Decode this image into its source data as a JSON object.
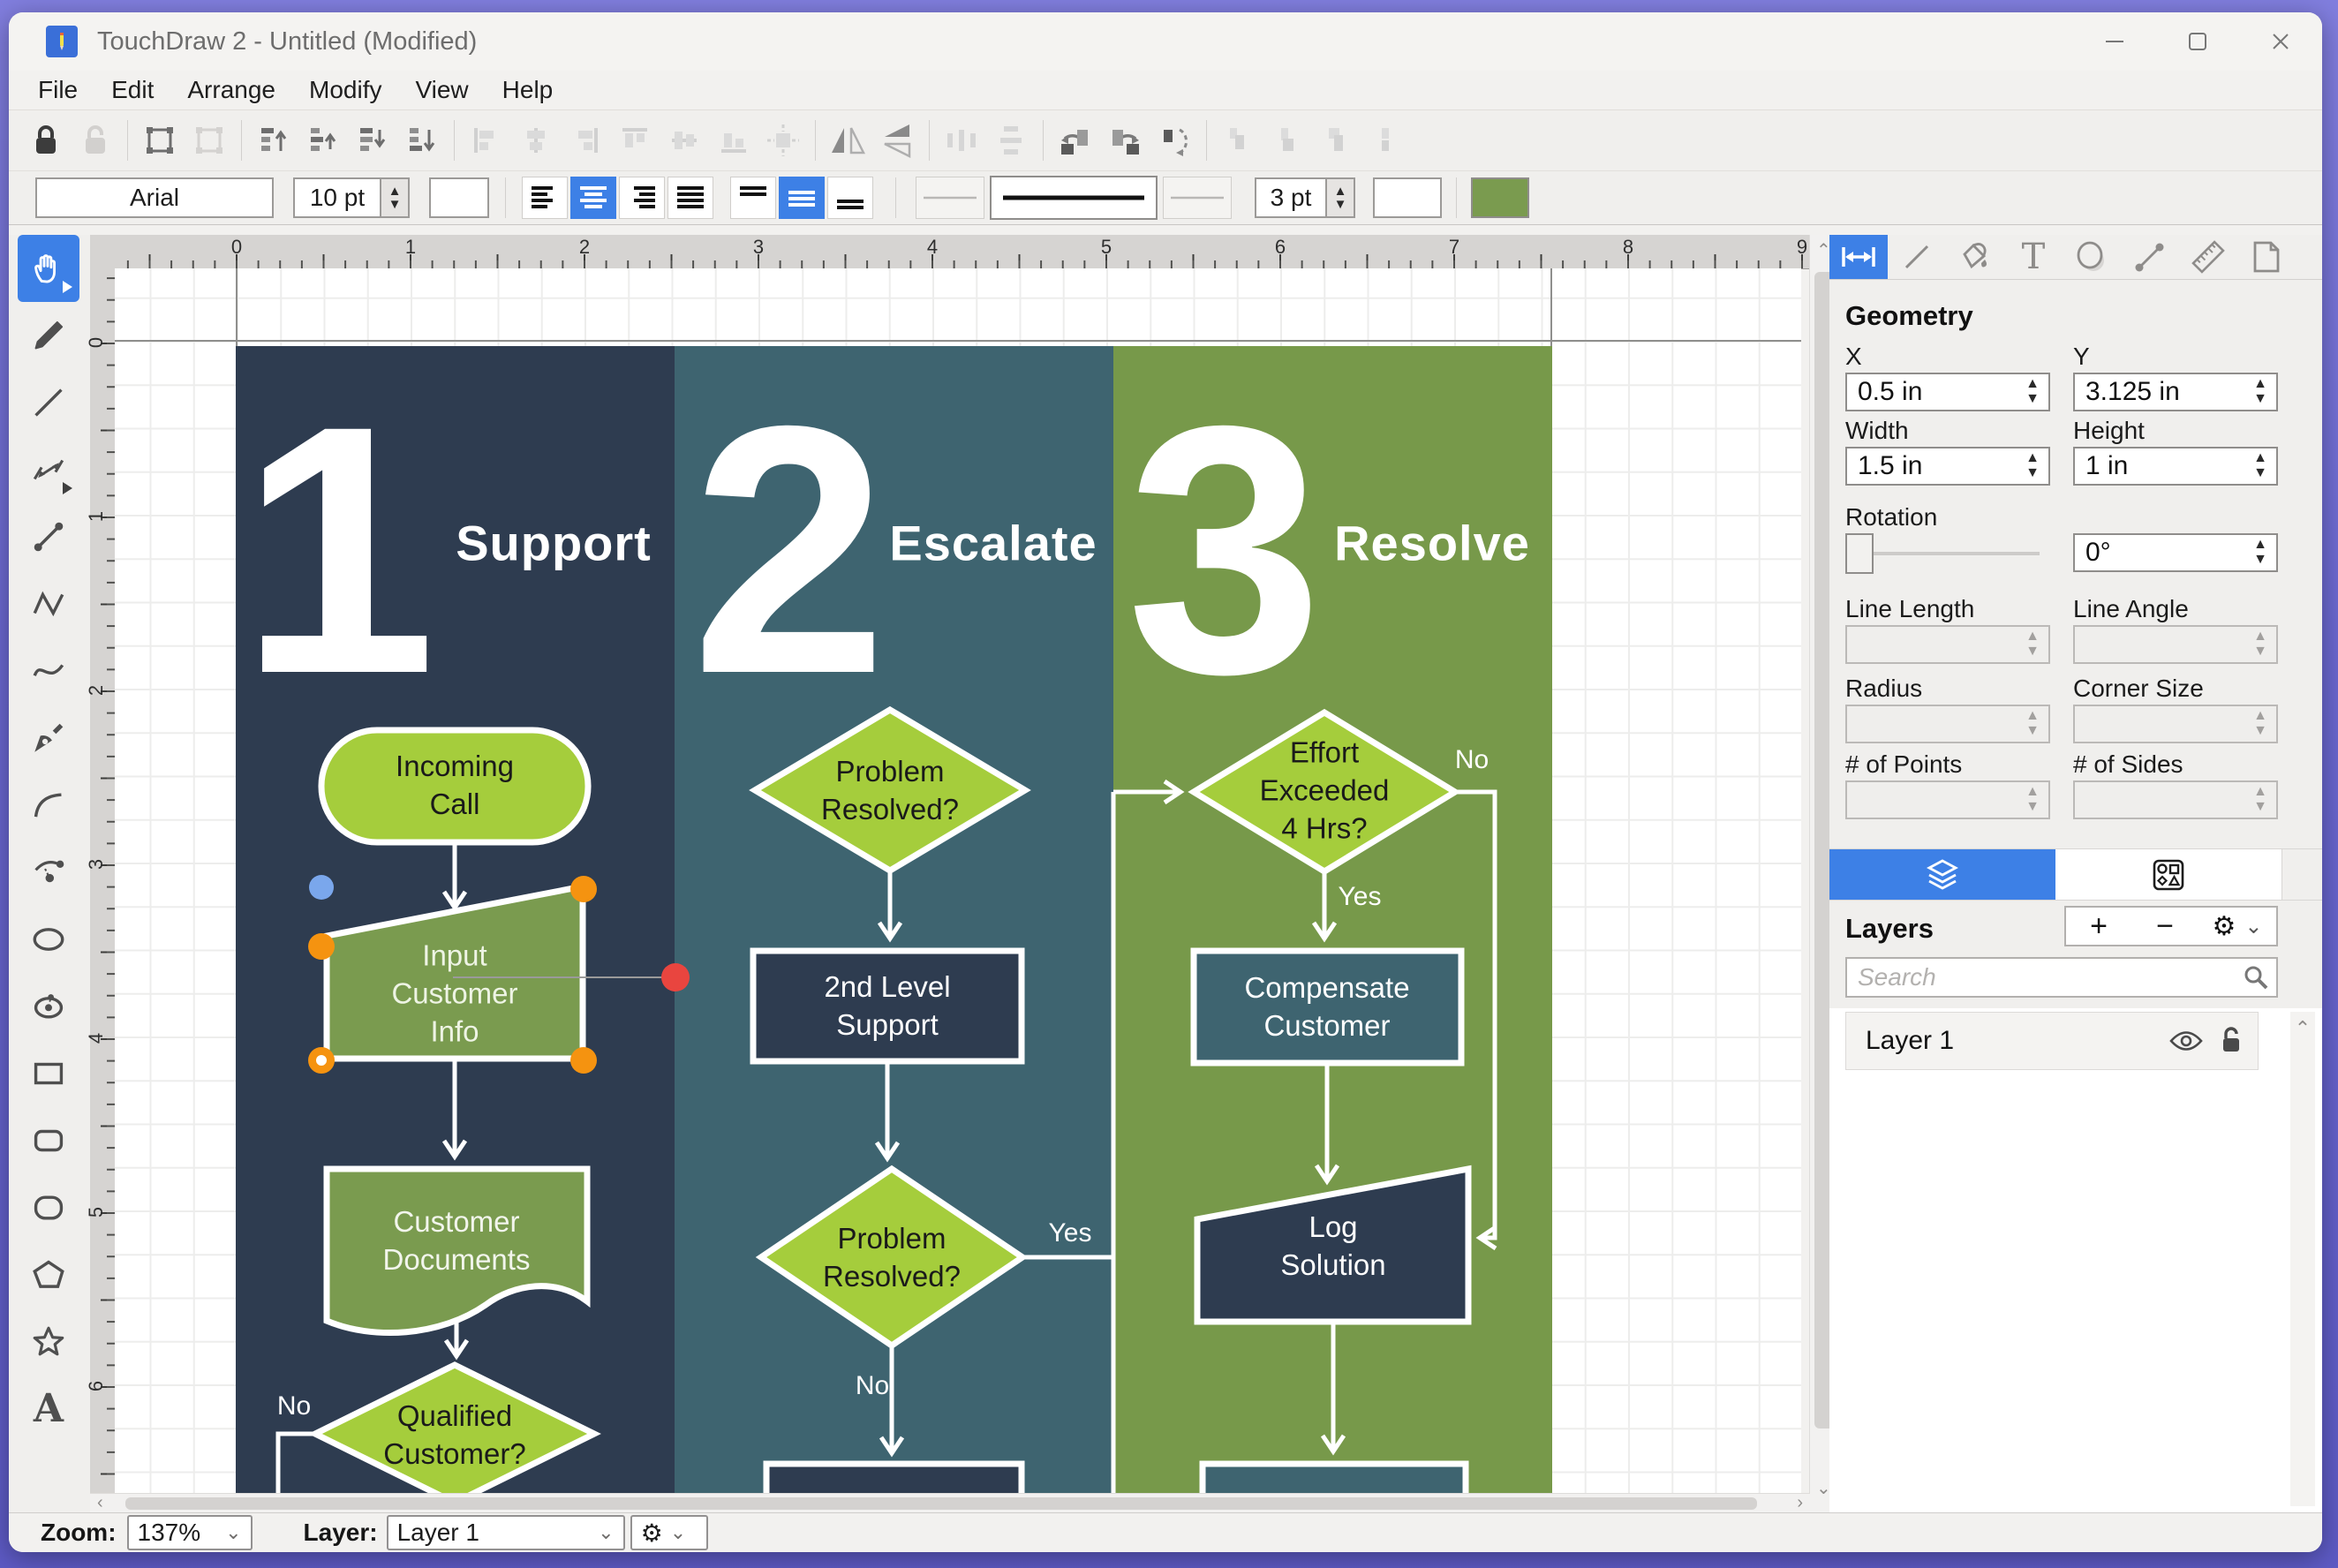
{
  "window": {
    "title": "TouchDraw 2 - Untitled (Modified)"
  },
  "menu": {
    "items": [
      "File",
      "Edit",
      "Arrange",
      "Modify",
      "View",
      "Help"
    ]
  },
  "toolbar": {
    "font": "Arial",
    "font_size": "10 pt",
    "line_width": "3 pt",
    "fill_color": "#7a9b4f",
    "icons_row1": [
      "lock",
      "unlock",
      "group",
      "ungroup",
      "bring-to-front",
      "bring-forward",
      "send-backward",
      "send-to-back",
      "align-left",
      "align-center",
      "align-right",
      "align-top",
      "align-middle",
      "align-bottom",
      "center-on-canvas",
      "flip-horizontal",
      "flip-vertical",
      "distribute-horizontal",
      "distribute-vertical",
      "rotate-left",
      "rotate-right",
      "rotate-custom",
      "join",
      "split",
      "lock-aspect",
      "anchor"
    ]
  },
  "palette": {
    "tools": [
      "select-pan",
      "pencil",
      "line",
      "dimension-line",
      "connector",
      "polyline",
      "curve",
      "pen",
      "arc",
      "arc-endpoints",
      "ellipse",
      "center-ellipse",
      "rectangle",
      "rounded-rectangle",
      "squircle",
      "polygon",
      "star",
      "text"
    ],
    "selected": "select-pan"
  },
  "rulers": {
    "horizontal": [
      "0",
      "1",
      "2",
      "3",
      "4",
      "5",
      "6",
      "7",
      "8",
      "9"
    ],
    "vertical": [
      "0",
      "1",
      "2",
      "3",
      "4",
      "5",
      "6"
    ]
  },
  "canvas": {
    "columns": [
      {
        "number": "1",
        "label": "Support",
        "color": "#2e3c50"
      },
      {
        "number": "2",
        "label": "Escalate",
        "color": "#3e6470"
      },
      {
        "number": "3",
        "label": "Resolve",
        "color": "#77994a"
      }
    ],
    "nodes": {
      "incoming_call": "Incoming\nCall",
      "input_customer_info": "Input\nCustomer\nInfo",
      "customer_documents": "Customer\nDocuments",
      "qualified_customer": "Qualified\nCustomer?",
      "problem_resolved_1": "Problem\nResolved?",
      "second_level_support": "2nd Level\nSupport",
      "problem_resolved_2": "Problem\nResolved?",
      "effort_exceeded": "Effort\nExceeded\n4 Hrs?",
      "compensate_customer": "Compensate\nCustomer",
      "log_solution": "Log\nSolution"
    },
    "edge_labels": {
      "no_qualified": "No",
      "yes_problem2": "Yes",
      "no_problem2": "No",
      "no_effort": "No",
      "yes_effort": "Yes"
    },
    "shape_colors": {
      "bright_green": "#a5cd3c",
      "olive": "#7a9b4f",
      "navy": "#2e3c50",
      "teal": "#3e6470"
    }
  },
  "panel": {
    "tabs": [
      "geometry",
      "stroke",
      "fill",
      "text",
      "shadow",
      "connection",
      "ruler",
      "page"
    ],
    "selected_tab": "geometry",
    "geometry": {
      "title": "Geometry",
      "fields": [
        {
          "label": "X",
          "value": "0.5 in"
        },
        {
          "label": "Y",
          "value": "3.125 in"
        },
        {
          "label": "Width",
          "value": "1.5 in"
        },
        {
          "label": "Height",
          "value": "1 in"
        },
        {
          "label": "Line Length",
          "value": ""
        },
        {
          "label": "Line Angle",
          "value": ""
        },
        {
          "label": "Radius",
          "value": ""
        },
        {
          "label": "Corner Size",
          "value": ""
        },
        {
          "label": "# of Points",
          "value": ""
        },
        {
          "label": "# of Sides",
          "value": ""
        }
      ],
      "rotation": {
        "label": "Rotation",
        "value": "0°"
      }
    },
    "layers": {
      "title": "Layers",
      "add_label": "+",
      "remove_label": "−",
      "search_placeholder": "Search",
      "items": [
        {
          "name": "Layer 1"
        }
      ]
    }
  },
  "statusbar": {
    "zoom_label": "Zoom:",
    "zoom_value": "137%",
    "layer_label": "Layer:",
    "layer_value": "Layer 1"
  }
}
